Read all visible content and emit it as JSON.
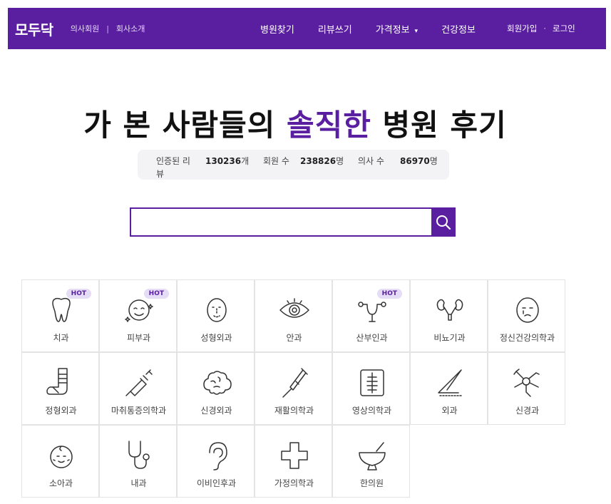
{
  "nav": {
    "logo": "모두닥",
    "doctor_member": "의사회원",
    "divider": "|",
    "about": "회사소개",
    "menu": [
      "병원찾기",
      "리뷰쓰기",
      "가격정보",
      "건강정보"
    ],
    "caret": "▾",
    "signup": "회원가입",
    "dot": "·",
    "login": "로그인"
  },
  "hero": {
    "title_before": "가 본 사람들의 ",
    "title_accent": "솔직한",
    "title_after": " 병원 후기"
  },
  "stats": {
    "reviews_label": "인증된 리뷰",
    "reviews_value": "130236",
    "reviews_unit": "개",
    "members_label": "회원 수",
    "members_value": "238826",
    "members_unit": "명",
    "doctors_label": "의사 수",
    "doctors_value": "86970",
    "doctors_unit": "명"
  },
  "search": {
    "placeholder": "",
    "button_icon": "search-icon"
  },
  "hot_label": "HOT",
  "departments": [
    {
      "label": "치과",
      "icon": "tooth-icon",
      "hot": true
    },
    {
      "label": "피부과",
      "icon": "skin-face-icon",
      "hot": true
    },
    {
      "label": "성형외과",
      "icon": "plastic-face-icon",
      "hot": false
    },
    {
      "label": "안과",
      "icon": "eye-icon",
      "hot": false
    },
    {
      "label": "산부인과",
      "icon": "uterus-icon",
      "hot": true
    },
    {
      "label": "비뇨기과",
      "icon": "kidney-icon",
      "hot": false
    },
    {
      "label": "정신건강의학과",
      "icon": "sad-face-icon",
      "hot": false
    },
    {
      "label": "정형외과",
      "icon": "cast-leg-icon",
      "hot": false
    },
    {
      "label": "마취통증의학과",
      "icon": "syringe-icon",
      "hot": false
    },
    {
      "label": "신경외과",
      "icon": "brain-icon",
      "hot": false
    },
    {
      "label": "재활의학과",
      "icon": "crutch-icon",
      "hot": false
    },
    {
      "label": "영상의학과",
      "icon": "xray-icon",
      "hot": false
    },
    {
      "label": "외과",
      "icon": "scalpel-icon",
      "hot": false
    },
    {
      "label": "신경과",
      "icon": "neuron-icon",
      "hot": false
    },
    {
      "label": "소아과",
      "icon": "baby-face-icon",
      "hot": false
    },
    {
      "label": "내과",
      "icon": "stethoscope-icon",
      "hot": false
    },
    {
      "label": "이비인후과",
      "icon": "ear-icon",
      "hot": false
    },
    {
      "label": "가정의학과",
      "icon": "cross-icon",
      "hot": false
    },
    {
      "label": "한의원",
      "icon": "mortar-icon",
      "hot": false
    }
  ],
  "colors": {
    "brand": "#5a1fa0",
    "hot_bg": "#e5dcf5"
  }
}
